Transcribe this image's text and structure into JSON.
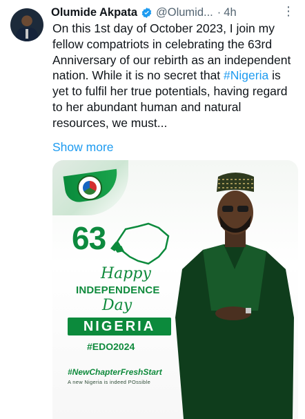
{
  "post": {
    "author_name": "Olumide Akpata",
    "author_handle": "@Olumid...",
    "separator": "·",
    "time": "4h",
    "body_before": "On this 1st day of October 2023, I join my fellow compatriots in celebrating the 63rd Anniversary of our rebirth as an independent nation. While it is no secret that ",
    "hashtag": "#Nigeria",
    "body_after": " is yet to fulfil her true potentials, having regard to her abundant human and natural resources, we must...",
    "show_more": "Show more"
  },
  "poster": {
    "number": "63",
    "happy": "Happy",
    "independence": "INDEPENDENCE",
    "day": "Day",
    "country": "NIGERIA",
    "hashtag_edo": "#EDO2024",
    "hashtag_fresh": "#NewChapterFreshStart",
    "tagline": "A new Nigeria is indeed POssible"
  },
  "colors": {
    "accent_blue": "#1d9bf0",
    "poster_green": "#0c8a3c",
    "verified": "#1d9bf0"
  },
  "icons": {
    "verified": "verified-badge-icon",
    "more": "more-options-icon"
  }
}
